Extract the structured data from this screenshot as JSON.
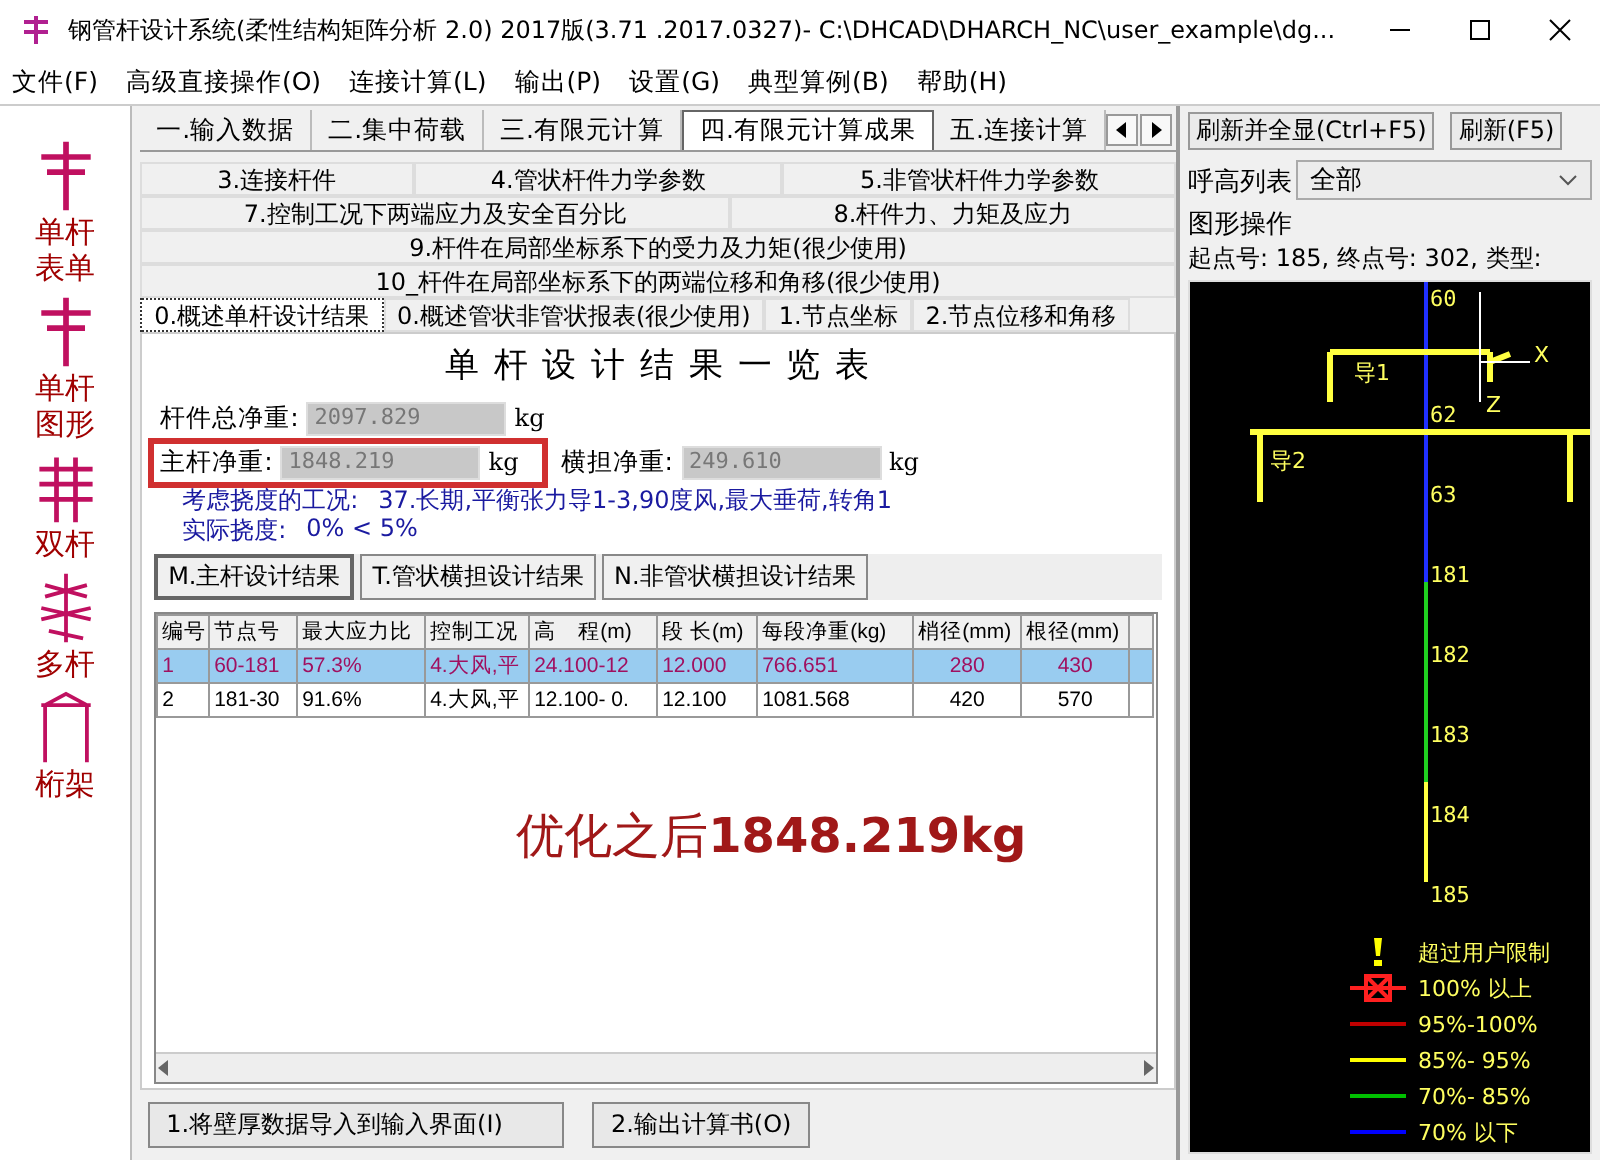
{
  "window": {
    "title": "钢管杆设计系统(柔性结构矩阵分析 2.0) 2017版(3.71 .2017.0327)- C:\\DHCAD\\DHARCH_NC\\user_example\\dg..."
  },
  "menu": [
    "文件(F)",
    "高级直接操作(O)",
    "连接计算(L)",
    "输出(P)",
    "设置(G)",
    "典型算例(B)",
    "帮助(H)"
  ],
  "toolbar": [
    {
      "label": "单杆表单",
      "kind": "single"
    },
    {
      "label": "单杆图形",
      "kind": "single"
    },
    {
      "label": "双杆",
      "kind": "double"
    },
    {
      "label": "多杆",
      "kind": "multi"
    },
    {
      "label": "桁架",
      "kind": "truss"
    }
  ],
  "main_tabs": [
    {
      "label": "一.输入数据",
      "selected": false
    },
    {
      "label": "二.集中荷载",
      "selected": false
    },
    {
      "label": "三.有限元计算",
      "selected": false
    },
    {
      "label": "四.有限元计算成果",
      "selected": true
    },
    {
      "label": "五.连接计算",
      "selected": false
    }
  ],
  "sub_tabs": [
    [
      {
        "label": "3.连接杆件",
        "selected": false
      },
      {
        "label": "4.管状杆件力学参数",
        "selected": false
      },
      {
        "label": "5.非管状杆件力学参数",
        "selected": false
      }
    ],
    [
      {
        "label": "7.控制工况下两端应力及安全百分比",
        "selected": false
      },
      {
        "label": "8.杆件力、力矩及应力",
        "selected": false
      }
    ],
    [
      {
        "label": "9.杆件在局部坐标系下的受力及力矩(很少使用)",
        "selected": false
      }
    ],
    [
      {
        "label": "10_杆件在局部坐标系下的两端位移和角移(很少使用)",
        "selected": false
      }
    ],
    [
      {
        "label": "0.概述单杆设计结果",
        "selected": true
      },
      {
        "label": "0.概述管状非管状报表(很少使用)",
        "selected": false
      },
      {
        "label": "1.节点坐标",
        "selected": false
      },
      {
        "label": "2.节点位移和角移",
        "selected": false
      }
    ]
  ],
  "report": {
    "title": "单 杆 设 计 结 果 一 览 表",
    "field_rows": [
      [
        {
          "label": "杆件总净重:",
          "value": "2097.829",
          "unit": "kg",
          "highlighted": false,
          "disabled": true
        }
      ],
      [
        {
          "label": "主杆净重:",
          "value": "1848.219",
          "unit": "kg",
          "highlighted": true,
          "disabled": true
        },
        {
          "label": "横担净重:",
          "value": "249.610",
          "unit": "kg",
          "highlighted": false,
          "disabled": true
        }
      ]
    ],
    "notes": [
      {
        "label": "考虑挠度的工况:",
        "value": "37.长期,平衡张力导1-3,90度风,最大垂荷,转角1"
      },
      {
        "label": "实际挠度:",
        "value": "0% < 5%"
      }
    ]
  },
  "result_tabs": [
    {
      "label": "M.主杆设计结果",
      "selected": true
    },
    {
      "label": "T.管状横担设计结果",
      "selected": false
    },
    {
      "label": "N.非管状横担设计结果",
      "selected": false
    }
  ],
  "table": {
    "columns": [
      "编号",
      "节点号",
      "最大应力比",
      "控制工况",
      "高　程(m)",
      "段 长(m)",
      "每段净重(kg)",
      "梢径(mm)",
      "根径(mm)"
    ],
    "rows": [
      {
        "cells": [
          "1",
          "60-181",
          "57.3%",
          "4.大风,平",
          "24.100-12",
          "12.000",
          "766.651",
          "280",
          "430"
        ],
        "selected": true
      },
      {
        "cells": [
          "2",
          "181-30",
          "91.6%",
          "4.大风,平",
          "12.100- 0.",
          "12.100",
          "1081.568",
          "420",
          "570"
        ],
        "selected": false
      }
    ]
  },
  "annotation": "优化之后**1848.219kg**",
  "buttons": [
    "1.将壁厚数据导入到输入界面(I)",
    "2.输出计算书(O)"
  ],
  "right_panel": {
    "buttons": [
      "刷新并全显(Ctrl+F5)",
      "刷新(F5)"
    ],
    "height_list": {
      "label": "呼高列表",
      "value": "全部"
    },
    "section_label": "图形操作",
    "info": "起点号: 185, 终点号: 302, 类型:",
    "canvas": {
      "nodes": [
        "60",
        "62",
        "63",
        "181",
        "182",
        "183",
        "184",
        "185"
      ],
      "axis_labels": [
        "X",
        "Z"
      ],
      "guide_labels": [
        "导1",
        "导2"
      ],
      "legend": [
        {
          "label": "超过用户限制",
          "kind": "warning",
          "color": "#ffff00"
        },
        {
          "label": "100% 以上",
          "kind": "box",
          "color": "#ff2020"
        },
        {
          "label": "95%-100%",
          "kind": "line",
          "color": "#c00000"
        },
        {
          "label": "85%- 95%",
          "kind": "line",
          "color": "#ffff00"
        },
        {
          "label": "70%- 85%",
          "kind": "line",
          "color": "#00c000"
        },
        {
          "label": "70% 以下",
          "kind": "line",
          "color": "#0000ff"
        }
      ]
    }
  }
}
